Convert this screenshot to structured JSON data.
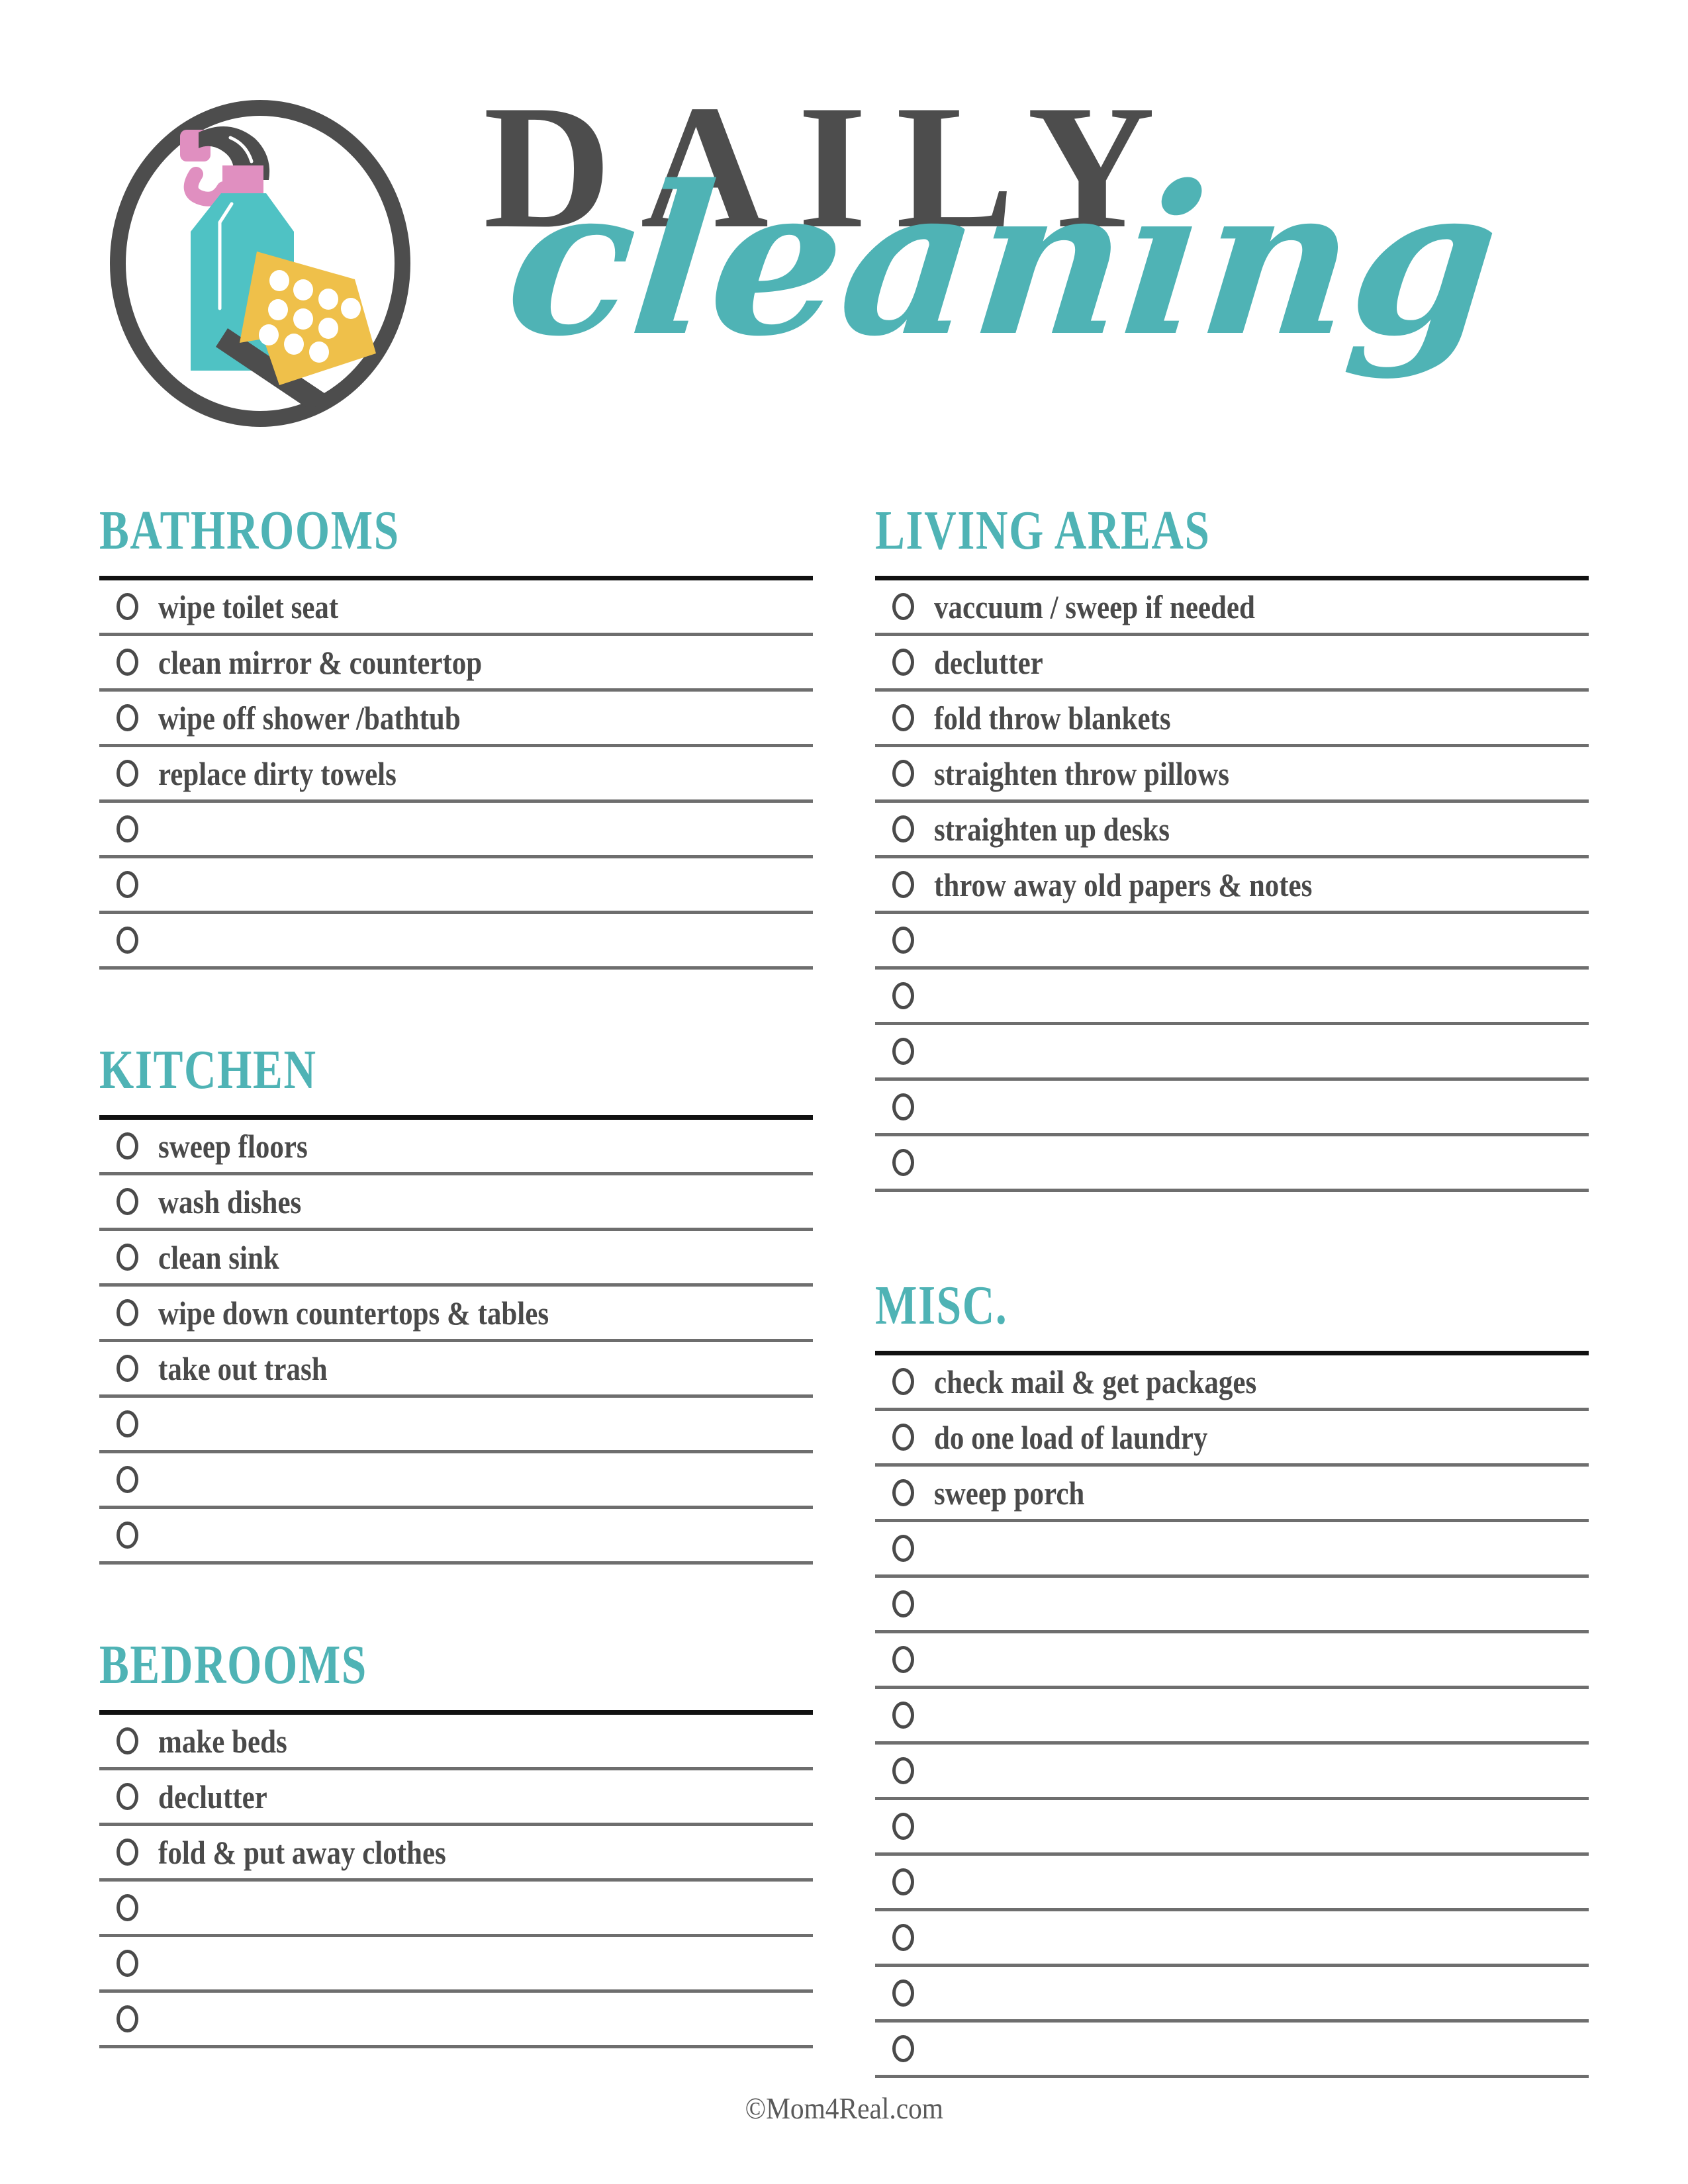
{
  "document": {
    "title_primary": "DAILY",
    "title_script": "cleaning",
    "footer": "©Mom4Real.com"
  },
  "colors": {
    "accent_teal": "#4fb3b5",
    "heading_gray": "#4d4d4d",
    "text_gray": "#4a4a4a",
    "rule_gray": "#6e6e6e",
    "rule_heavy": "#111111",
    "logo_bottle": "#4fc2c4",
    "logo_pink": "#e49bc4",
    "logo_yellow": "#efc04a",
    "logo_dark": "#4d4d4d"
  },
  "logo": {
    "name": "spray-bottle-and-sponge-in-circle",
    "parts": [
      "circle-outline",
      "spray-bottle",
      "pink-cap",
      "pink-trigger",
      "yellow-sponge",
      "dark-squeegee"
    ]
  },
  "columns": {
    "left": [
      {
        "id": "bathrooms",
        "heading": "BATHROOMS",
        "items": [
          "wipe toilet seat",
          "clean mirror & countertop",
          "wipe off shower /bathtub",
          "replace dirty towels"
        ],
        "blank_rows": 3
      },
      {
        "id": "kitchen",
        "heading": "KITCHEN",
        "items": [
          "sweep floors",
          "wash dishes",
          "clean sink",
          "wipe down countertops & tables",
          "take out trash"
        ],
        "blank_rows": 3
      },
      {
        "id": "bedrooms",
        "heading": "BEDROOMS",
        "items": [
          "make beds",
          "declutter",
          "fold & put away clothes"
        ],
        "blank_rows": 3
      }
    ],
    "right": [
      {
        "id": "living-areas",
        "heading": "LIVING AREAS",
        "items": [
          "vaccuum / sweep if needed",
          "declutter",
          "fold throw blankets",
          "straighten throw pillows",
          "straighten up desks",
          "throw away old papers & notes"
        ],
        "blank_rows": 5
      },
      {
        "id": "misc",
        "heading": "MISC.",
        "items": [
          "check mail & get packages",
          "do one load of laundry",
          "sweep porch"
        ],
        "blank_rows": 10
      }
    ]
  }
}
